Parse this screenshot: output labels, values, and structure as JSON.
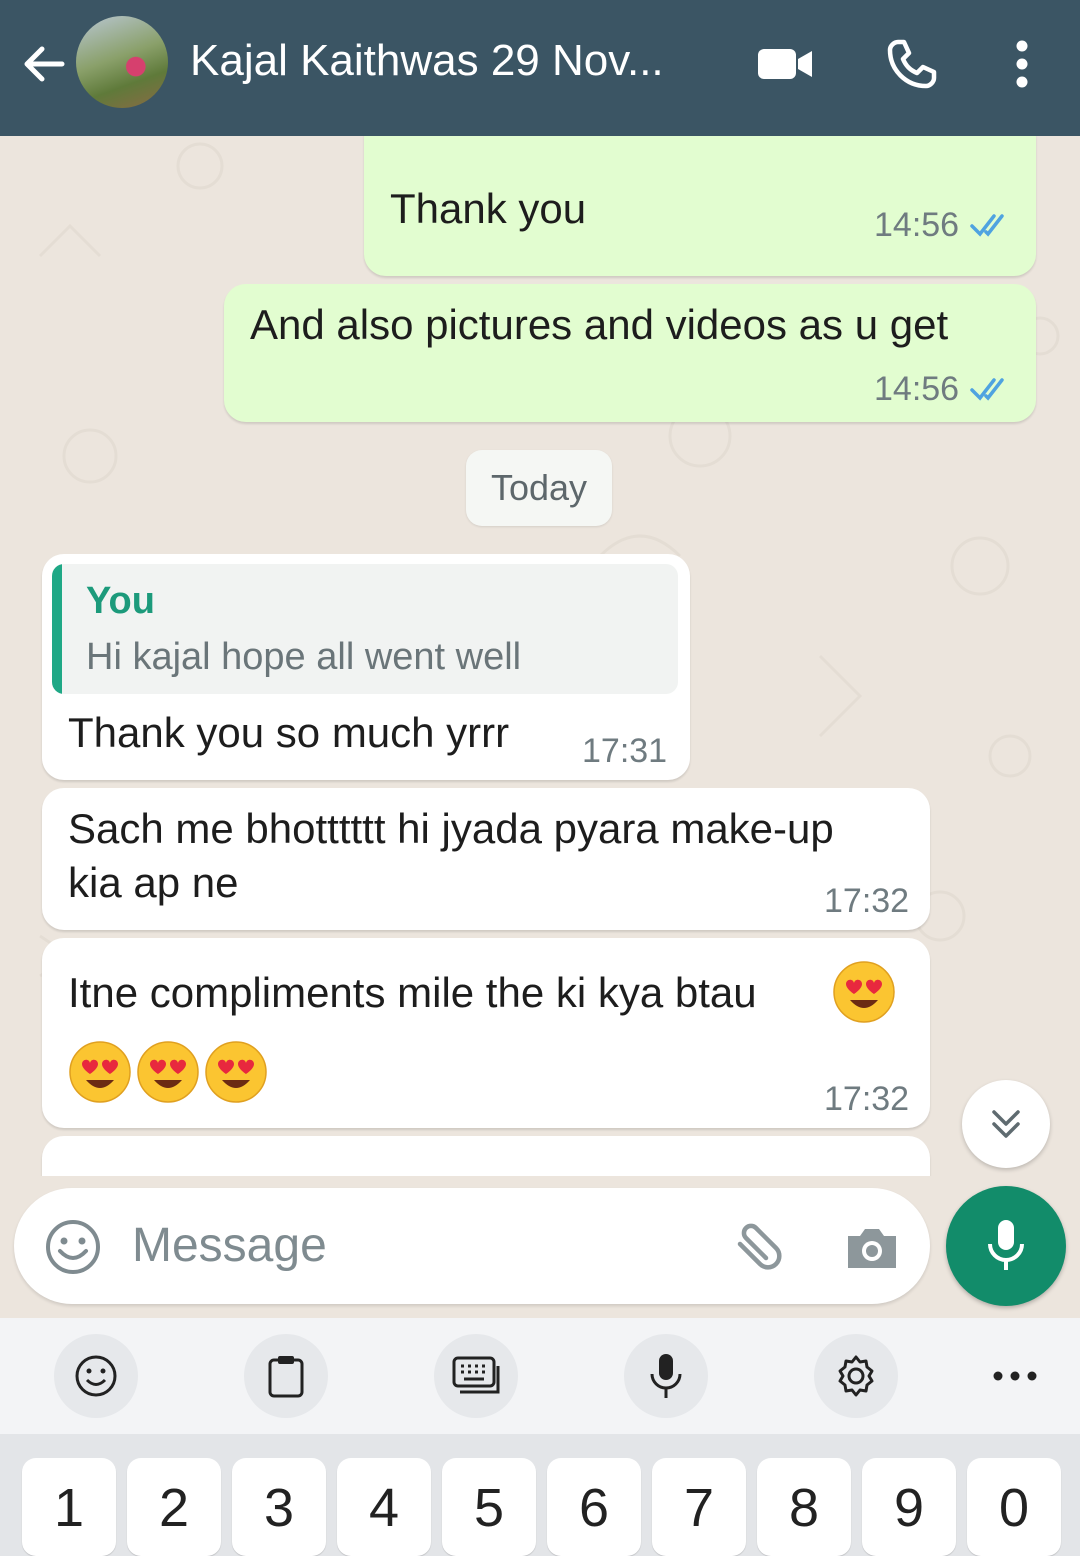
{
  "header": {
    "contact_name": "Kajal Kaithwas 29 Nov..."
  },
  "messages": {
    "out_partial_text": "Thank you",
    "out_partial_time": "14:56",
    "out_2_text": "And also pictures and videos as u get",
    "out_2_time": "14:56",
    "date_chip": "Today",
    "in_1_quote_name": "You",
    "in_1_quote_text": "Hi kajal hope all went well",
    "in_1_text": "Thank you so much yrrr",
    "in_1_time": "17:31",
    "in_2_line1": "Sach me bhotttttt hi jyada pyara make-up",
    "in_2_line2": "kia ap ne",
    "in_2_time": "17:32",
    "in_3_text": "Itne compliments mile the ki kya btau",
    "in_3_time": "17:32"
  },
  "composer": {
    "placeholder": "Message"
  },
  "keyboard": {
    "keys": [
      "1",
      "2",
      "3",
      "4",
      "5",
      "6",
      "7",
      "8",
      "9",
      "0"
    ]
  },
  "colors": {
    "header_bg": "#3b5564",
    "outgoing_bubble": "#e2fdd0",
    "incoming_bubble": "#ffffff",
    "accent_green": "#128c6a",
    "read_ticks": "#4fa3e0"
  },
  "icons": {
    "back": "arrow-left-icon",
    "video": "video-camera-icon",
    "call": "phone-icon",
    "more": "more-vertical-icon",
    "emoji": "smiley-icon",
    "attach": "paperclip-icon",
    "camera": "camera-icon",
    "mic": "microphone-icon",
    "scroll": "double-chevron-down-icon",
    "heart_eyes": "heart-eyes-emoji-icon"
  }
}
